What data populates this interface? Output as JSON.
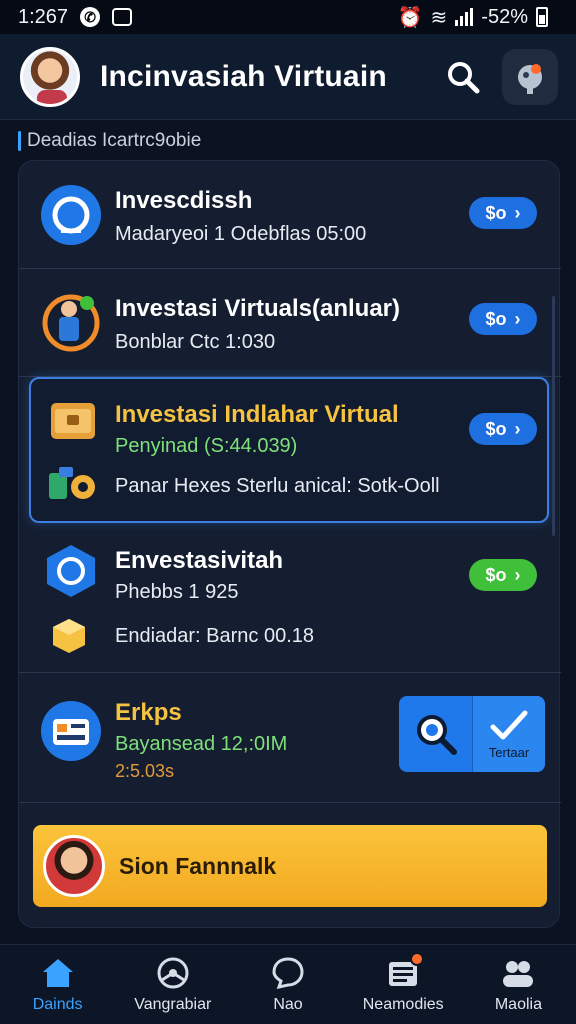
{
  "status_bar": {
    "time": "1:267",
    "battery_text": "-52%",
    "icons": [
      "whatsapp-icon",
      "gallery-icon",
      "alarm-icon",
      "wifi-icon",
      "signal-icon",
      "battery-icon"
    ]
  },
  "header": {
    "title": "Incinvasiah Virtuain",
    "search_icon": "search-icon",
    "assistant_icon": "robot-icon"
  },
  "section": {
    "label": "Deadias Icartrc9obie"
  },
  "items": [
    {
      "title": "Invescdissh",
      "subtitle": "Madaryeoi 1 Odebflas 05:00",
      "pill_label": "$o",
      "icon": "blue-circle-icon"
    },
    {
      "title": "Investasi Virtuals(anluar)",
      "subtitle": "Bonblar Ctc 1:030",
      "pill_label": "$o",
      "icon": "person-coin-icon"
    },
    {
      "title": "Investasi Indlahar Virtual",
      "subtitle": "Penyinad (S:44.039)",
      "detail": "Panar Hexes Sterlu anical: Sotk-Ooll",
      "pill_label": "$o",
      "icon": "chest-icon",
      "detail_icon": "gears-icon"
    },
    {
      "title": "Envestasivitah",
      "subtitle": "Phebbs 1 925",
      "detail": "Endiadar: Barnc 00.18",
      "pill_label": "$o",
      "icon": "hexagon-icon",
      "detail_icon": "cube-icon"
    },
    {
      "title": "Erkps",
      "subtitle": "Bayansead 12,:0IM",
      "detail": "2:5.03s",
      "icon": "dashboard-card-icon"
    }
  ],
  "action_tile": {
    "label": "Tertaar",
    "left_icon": "magnifier-icon",
    "right_icon": "checkmark-icon"
  },
  "banner": {
    "label": "Sion Fannnalk",
    "avatar": "user-avatar"
  },
  "bottom_nav": [
    {
      "label": "Dainds",
      "icon": "home-icon",
      "active": true
    },
    {
      "label": "Vangrabiar",
      "icon": "steering-icon",
      "active": false
    },
    {
      "label": "Nao",
      "icon": "chat-icon",
      "active": false
    },
    {
      "label": "Neamodies",
      "icon": "list-badge-icon",
      "active": false
    },
    {
      "label": "Maolia",
      "icon": "people-icon",
      "active": false
    }
  ],
  "colors": {
    "background": "#0b1322",
    "card": "#141e30",
    "accent": "#1e6fe0",
    "highlight_border": "#3d7fe0",
    "yellow_title": "#f5c242",
    "green_text": "#7ee07a",
    "banner": "#fbc43b"
  }
}
